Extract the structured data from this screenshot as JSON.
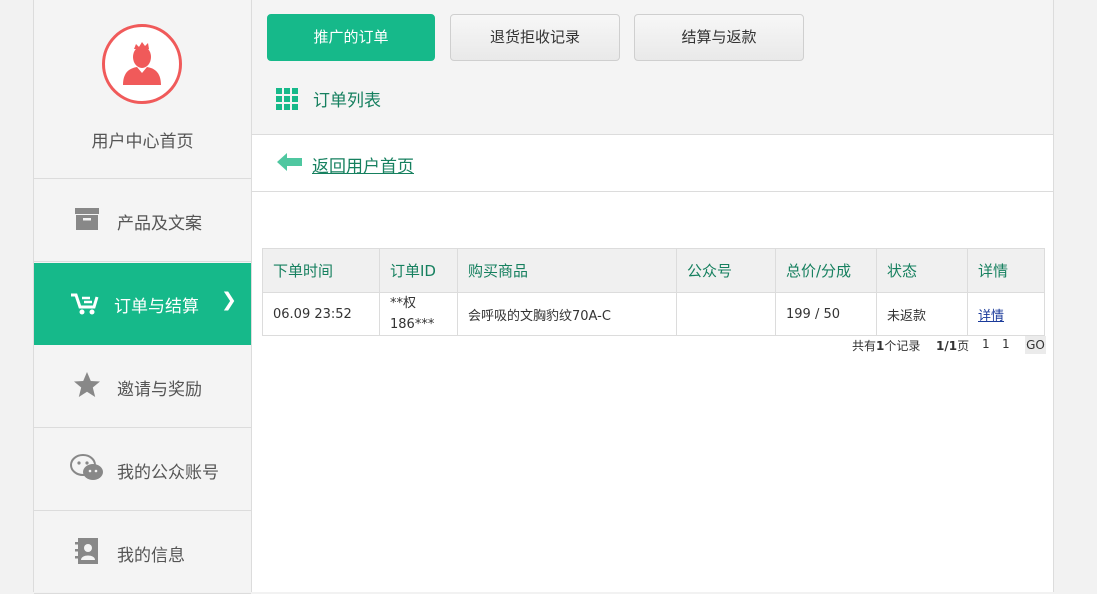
{
  "sidebar": {
    "profile_label": "用户中心首页",
    "items": [
      {
        "label": "产品及文案",
        "icon": "archive-box-icon"
      },
      {
        "label": "订单与结算",
        "icon": "cart-icon",
        "chevron": "❯"
      },
      {
        "label": "邀请与奖励",
        "icon": "star-icon"
      },
      {
        "label": "我的公众账号",
        "icon": "wechat-icon"
      },
      {
        "label": "我的信息",
        "icon": "contacts-book-icon"
      }
    ]
  },
  "tabs": [
    {
      "label": "推广的订单",
      "active": true
    },
    {
      "label": "退货拒收记录",
      "active": false
    },
    {
      "label": "结算与返款",
      "active": false
    }
  ],
  "section_title": "订单列表",
  "back_link": "返回用户首页",
  "table": {
    "headers": [
      "下单时间",
      "订单ID",
      "购买商品",
      "公众号",
      "总价/分成",
      "状态",
      "详情"
    ],
    "rows": [
      {
        "time": "06.09 23:52",
        "order_id_line1": "**权",
        "order_id_line2": "186***",
        "product": "会呼吸的文胸豹纹70A-C",
        "account": "",
        "price_share": "199 / 50",
        "status": "未返款",
        "detail": "详情"
      }
    ]
  },
  "pager": {
    "total_prefix": "共有",
    "total_count": "1",
    "total_suffix": "个记录",
    "page_current": "1/1",
    "page_suffix": "页",
    "page_link": "1",
    "page_input": "1",
    "go": "GO"
  },
  "colors": {
    "accent": "#16b98a",
    "accent_text": "#16805f",
    "avatar": "#f05a5a",
    "status": "#3a7a1a",
    "link": "#1a3a9a"
  }
}
